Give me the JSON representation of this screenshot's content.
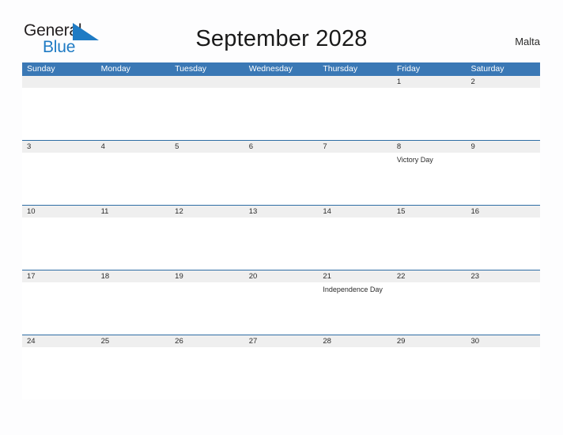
{
  "brand": {
    "name_part1": "General",
    "name_part2": "Blue",
    "flag_icon": "blue-flag-triangle-icon",
    "accent_color": "#1f7bc4"
  },
  "header": {
    "title": "September 2028",
    "country": "Malta"
  },
  "theme": {
    "header_blue": "#3a78b5",
    "row_divider_blue": "#2e6da4",
    "date_band_gray": "#efefef",
    "page_background": "#fdfdfe",
    "text_color": "#2b2b2b"
  },
  "calendar": {
    "weekdays": [
      "Sunday",
      "Monday",
      "Tuesday",
      "Wednesday",
      "Thursday",
      "Friday",
      "Saturday"
    ],
    "weeks": [
      {
        "dates": [
          "",
          "",
          "",
          "",
          "",
          "1",
          "2"
        ],
        "events": [
          "",
          "",
          "",
          "",
          "",
          "",
          ""
        ]
      },
      {
        "dates": [
          "3",
          "4",
          "5",
          "6",
          "7",
          "8",
          "9"
        ],
        "events": [
          "",
          "",
          "",
          "",
          "",
          "Victory Day",
          ""
        ]
      },
      {
        "dates": [
          "10",
          "11",
          "12",
          "13",
          "14",
          "15",
          "16"
        ],
        "events": [
          "",
          "",
          "",
          "",
          "",
          "",
          ""
        ]
      },
      {
        "dates": [
          "17",
          "18",
          "19",
          "20",
          "21",
          "22",
          "23"
        ],
        "events": [
          "",
          "",
          "",
          "",
          "Independence Day",
          "",
          ""
        ]
      },
      {
        "dates": [
          "24",
          "25",
          "26",
          "27",
          "28",
          "29",
          "30"
        ],
        "events": [
          "",
          "",
          "",
          "",
          "",
          "",
          ""
        ]
      }
    ]
  }
}
